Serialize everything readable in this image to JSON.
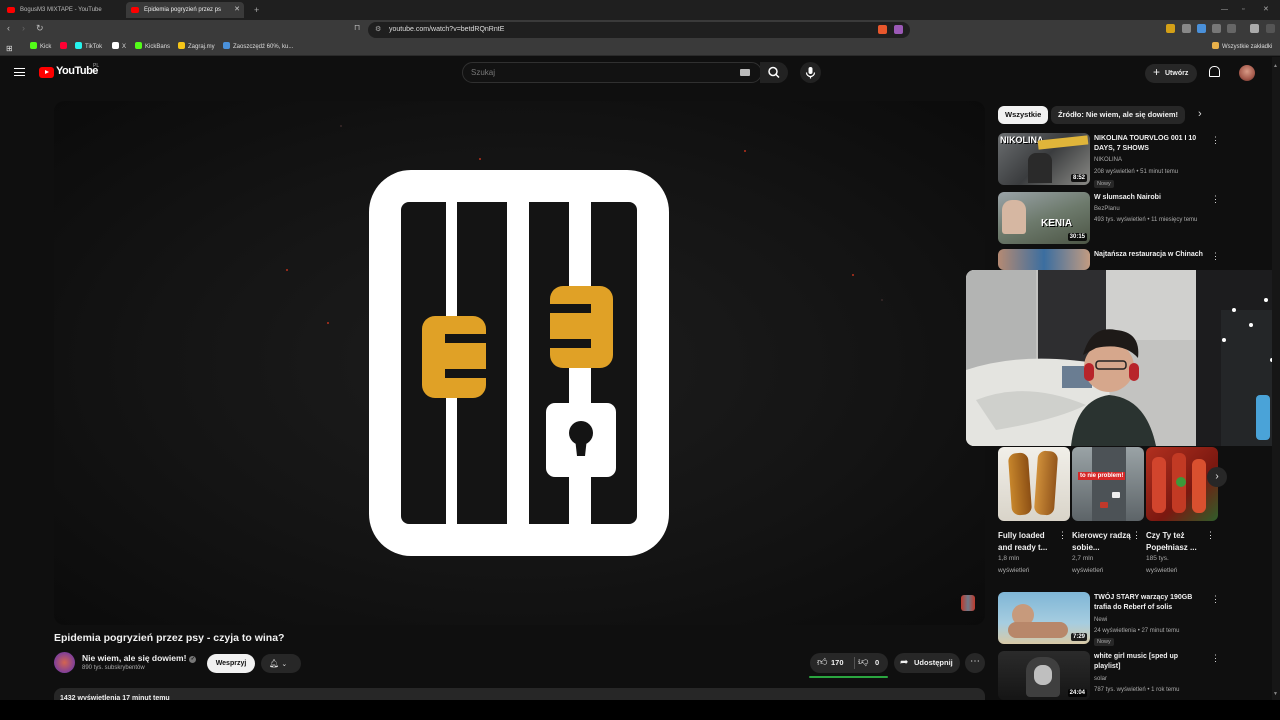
{
  "browser": {
    "tabs": [
      {
        "title": "BogusM3 MIXTAPE - YouTube"
      },
      {
        "title": "Epidemia pogryzień przez ps"
      }
    ],
    "url": "youtube.com/watch?v=betdRQnRntE",
    "bookmarks": [
      {
        "label": "Kick",
        "color": "#53fc18"
      },
      {
        "label": "",
        "color": "#ff0033"
      },
      {
        "label": "TikTok",
        "color": "#25f4ee"
      },
      {
        "label": "X",
        "color": "#ffffff"
      },
      {
        "label": "KickBans",
        "color": "#53fc18"
      },
      {
        "label": "Zagraj.my",
        "color": "#f5c518"
      },
      {
        "label": "Zaoszczędź 60%, ku...",
        "color": "#4a90d9"
      }
    ],
    "all_bookmarks": "Wszystkie zakładki"
  },
  "masthead": {
    "logo": "YouTube",
    "region": "PL",
    "search_placeholder": "Szukaj",
    "create_label": "Utwórz"
  },
  "video": {
    "title": "Epidemia pogryzień przez psy - czyja to wina?",
    "channel": "Nie wiem, ale się dowiem!",
    "subscribers": "890 tys. subskrybentów",
    "support_label": "Wesprzyj",
    "likes": "170",
    "dislikes": "0",
    "like_ratio": 1.0,
    "share_label": "Udostępnij",
    "description_meta": "1432 wyświetlenia  17 minut temu"
  },
  "chips": [
    {
      "label": "Wszystkie"
    },
    {
      "label": "Źródło: Nie wiem, ale się dowiem!"
    }
  ],
  "recommended_top": [
    {
      "title": "NIKOLINA TOURVLOG 001 I 10 DAYS, 7 SHOWS",
      "channel": "NIKOLINA",
      "meta": "208 wyświetleń • 51 minut temu",
      "badge": "Nowy",
      "duration": "8:52"
    },
    {
      "title": "W slumsach Nairobi",
      "channel": "BezPlanu",
      "meta": "493 tys. wyświetleń • 11 miesięcy temu",
      "badge": "",
      "duration": "30:15"
    },
    {
      "title": "Najtańsza restauracja w Chinach",
      "channel": "",
      "meta": "",
      "badge": "",
      "duration": ""
    }
  ],
  "shorts": [
    {
      "title": "Fully loaded and ready t...",
      "views": "1,8 mln",
      "views_label": "wyświetleń"
    },
    {
      "title": "Kierowcy radzą sobie...",
      "views": "2,7 mln",
      "views_label": "wyświetleń",
      "overlay": "to nie problem!"
    },
    {
      "title": "Czy Ty też Popełniasz ...",
      "views": "185 tys.",
      "views_label": "wyświetleń"
    }
  ],
  "recommended_bottom": [
    {
      "title": "TWÓJ STARY warzący 190GB trafia do Reberf of solis",
      "channel": "Newi",
      "meta": "24 wyświetlenia • 27 minut temu",
      "badge": "Nowy",
      "duration": "7:29"
    },
    {
      "title": "white girl music [sped up playlist]",
      "channel": "solar",
      "meta": "787 tys. wyświetleń • 1 rok temu",
      "badge": "",
      "duration": "24:04"
    }
  ],
  "thumb_text": {
    "nikolina": "NIKOLINA",
    "kenia": "KENIA"
  },
  "colors": {
    "accent_red": "#ff0000",
    "logo_orange": "#e0a126",
    "like_bar": "#2ba640"
  }
}
